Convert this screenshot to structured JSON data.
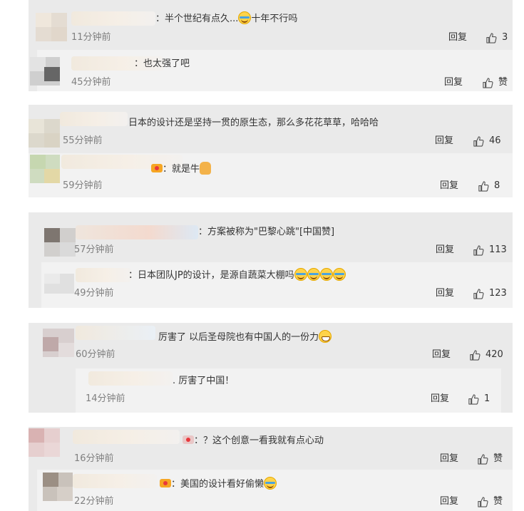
{
  "reply_label": "回复",
  "like_icon": "thumbs-up-icon",
  "threads": [
    {
      "comments": [
        {
          "text": "：半个世纪有点久...",
          "text_after": "十年不行吗",
          "emoji": "cry",
          "time": "11分钟前",
          "likes": "3"
        },
        {
          "text": "：也太强了吧",
          "time": "45分钟前",
          "likes": "赞"
        }
      ]
    },
    {
      "comments": [
        {
          "text": "日本的设计还是坚持一贯的原生态，那么多花花草草，哈哈哈",
          "time": "55分钟前",
          "likes": "46"
        },
        {
          "text": "：就是牛",
          "emoji": "thumbs-up",
          "time": "59分钟前",
          "likes": "8"
        }
      ]
    },
    {
      "comments": [
        {
          "text": "：方案被称为\"巴黎心跳\"[中国赞]",
          "time": "57分钟前",
          "likes": "113"
        },
        {
          "text": "：日本团队JP的设计，是源自蔬菜大棚吗",
          "emoji": "cry x4",
          "time": "49分钟前",
          "likes": "123"
        }
      ]
    },
    {
      "comments": [
        {
          "text": "厉害了 以后圣母院也有中国人的一份力",
          "emoji": "grin",
          "time": "60分钟前",
          "likes": "420"
        },
        {
          "text": ". 厉害了中国！",
          "time": "14分钟前",
          "likes": "1"
        }
      ]
    },
    {
      "comments": [
        {
          "text": "：？这个创意一看我就有点心动",
          "time": "16分钟前",
          "likes": "赞"
        },
        {
          "text": "：美国的设计看好偷懒",
          "emoji": "cry",
          "time": "22分钟前",
          "likes": "赞"
        }
      ]
    }
  ]
}
